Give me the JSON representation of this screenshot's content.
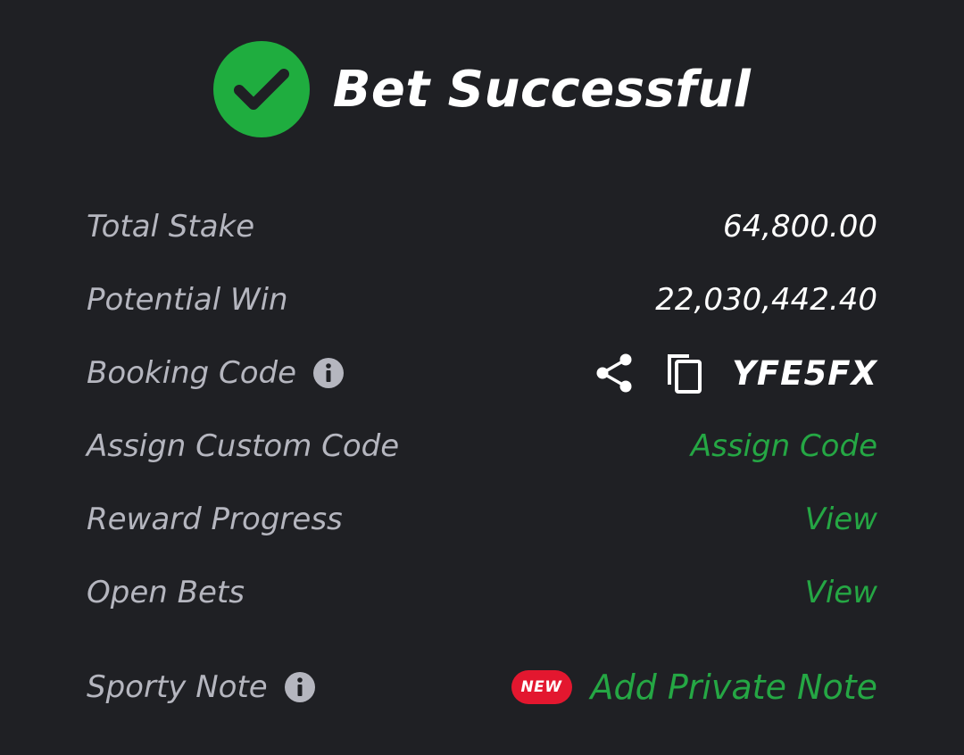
{
  "header": {
    "title": "Bet Successful",
    "icon": "check-circle-icon"
  },
  "colors": {
    "background": "#1f2024",
    "success_green": "#1fad3f",
    "link_green": "#25a744",
    "label_gray": "#b5b6bf",
    "badge_red": "#e3172f",
    "text_white": "#ffffff"
  },
  "rows": {
    "total_stake": {
      "label": "Total Stake",
      "value": "64,800.00"
    },
    "potential_win": {
      "label": "Potential Win",
      "value": "22,030,442.40"
    },
    "booking_code": {
      "label": "Booking Code",
      "info_icon": "info-icon",
      "share_icon": "share-icon",
      "copy_icon": "copy-icon",
      "value": "YFE5FX"
    },
    "assign_custom_code": {
      "label": "Assign Custom Code",
      "action": "Assign Code"
    },
    "reward_progress": {
      "label": "Reward Progress",
      "action": "View"
    },
    "open_bets": {
      "label": "Open Bets",
      "action": "View"
    },
    "sporty_note": {
      "label": "Sporty Note",
      "info_icon": "info-icon",
      "badge": "NEW",
      "action": "Add Private Note"
    }
  }
}
